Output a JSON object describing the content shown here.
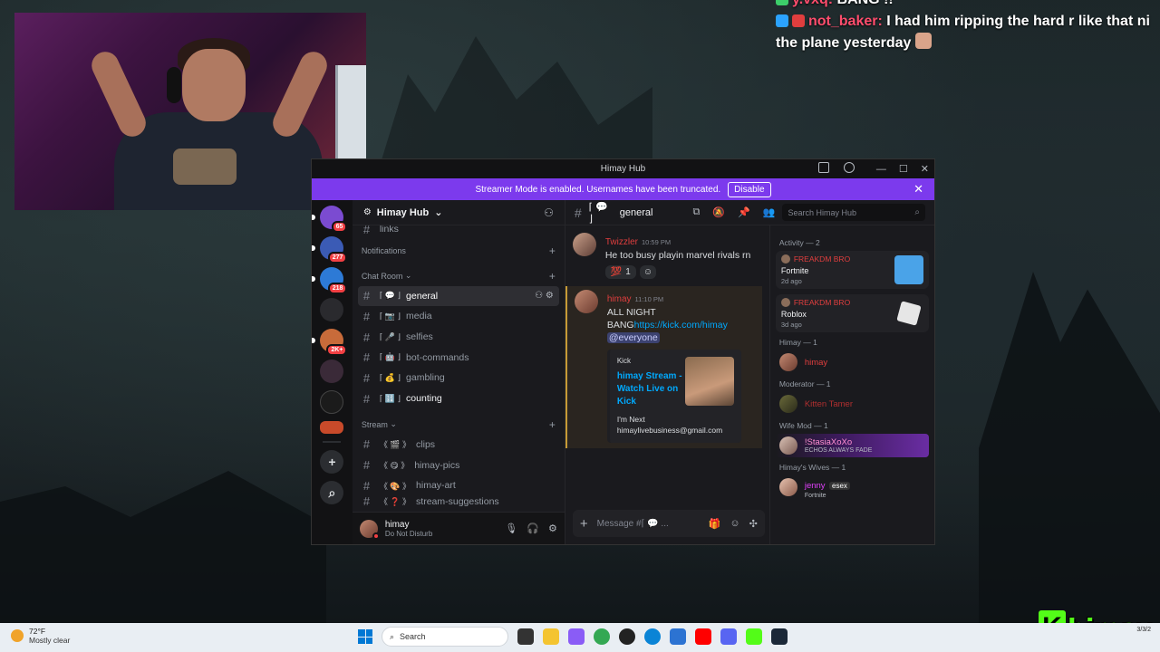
{
  "stream_chat": [
    {
      "user": "y.vxq:",
      "message": "BANG !!"
    },
    {
      "user": "not_baker:",
      "message": "I had him ripping the hard r like that ni",
      "message_line2": "the plane yesterday"
    }
  ],
  "window": {
    "title": "Himay Hub"
  },
  "banner": {
    "text": "Streamer Mode is enabled. Usernames have been truncated.",
    "button": "Disable",
    "close": "✕"
  },
  "rail": {
    "servers": [
      {
        "badge": "65",
        "color": "#7b4bd1"
      },
      {
        "badge": "277",
        "color": "#3b5bb5"
      },
      {
        "badge": "218",
        "color": "#2d7ad6"
      },
      {
        "badge": "",
        "color": "#2a2a2e"
      },
      {
        "badge": "2K+",
        "color": "#c86b3a"
      },
      {
        "badge": "",
        "color": "#3a2a38"
      },
      {
        "badge": "",
        "color": "#1b1b1b"
      },
      {
        "badge": "",
        "color": "#c84a2a"
      }
    ],
    "add_icon": "+",
    "explore_icon": "⌕"
  },
  "server": {
    "name": "Himay Hub",
    "chevron": "⌄"
  },
  "sidebar": {
    "top_partial": "links",
    "notifications_cat": "Notifications",
    "chatroom_cat": "Chat Room",
    "stream_cat": "Stream",
    "chatroom": [
      {
        "prefix": "⌈ 💬 ⌋",
        "name": "general",
        "active": true
      },
      {
        "prefix": "⌈ 📷 ⌋",
        "name": "media"
      },
      {
        "prefix": "⌈ 🎤 ⌋",
        "name": "selfies"
      },
      {
        "prefix": "⌈ 🤖 ⌋",
        "name": "bot-commands"
      },
      {
        "prefix": "⌈ 💰 ⌋",
        "name": "gambling"
      },
      {
        "prefix": "⌈ 🔢 ⌋",
        "name": "counting",
        "unread": true
      }
    ],
    "stream": [
      {
        "prefix": "《 🎬 》",
        "name": "clips"
      },
      {
        "prefix": "《 😋 》",
        "name": "himay-pics"
      },
      {
        "prefix": "《 🎨 》",
        "name": "himay-art"
      },
      {
        "prefix": "《 ❓ 》",
        "name": "stream-suggestions"
      }
    ]
  },
  "user_panel": {
    "name": "himay",
    "status": "Do Not Disturb"
  },
  "channel_header": {
    "prefix": "⌈ 💬 ⌋",
    "name": "general",
    "search_placeholder": "Search Himay Hub"
  },
  "messages": [
    {
      "author": "Twizzler",
      "time": "10:59 PM",
      "text": "He too busy playin marvel rivals rn",
      "reaction_emoji": "💯",
      "reaction_count": "1"
    },
    {
      "author": "himay",
      "time": "11:10 PM",
      "text_a": "ALL NIGHT",
      "text_b": "BANG",
      "link": "https://kick.com/himay",
      "mention": "@everyone",
      "embed": {
        "provider": "Kick",
        "title": "himay Stream - Watch Live on Kick",
        "description": "I'm Next himaylivebusiness@gmail.com"
      }
    }
  ],
  "composer": {
    "placeholder": "Message #⌈ 💬 ..."
  },
  "members": {
    "activity_cat": "Activity — 2",
    "activities": [
      {
        "user": "FREAKDM BRO",
        "game": "Fortnite",
        "time": "2d ago",
        "art_color": "#4aa3e8"
      },
      {
        "user": "FREAKDM BRO",
        "game": "Roblox",
        "time": "3d ago",
        "art_color": "#e6e6e6"
      }
    ],
    "groups": [
      {
        "title": "Himay — 1",
        "name": "himay",
        "color": "#e03e3e",
        "sub": ""
      },
      {
        "title": "Moderator — 1",
        "name": "Kitten Tamer",
        "color": "#b12f2f",
        "sub": ""
      },
      {
        "title": "Wife Mod — 1",
        "name": "!StasiaXoXo",
        "color": "#ff8fd1",
        "sub": "ECHOS ALWAYS FADE",
        "banner": true
      },
      {
        "title": "Himay's Wives — 1",
        "name": "jenny",
        "color": "#e040fb",
        "sub": "Fortnite",
        "tag": "esex"
      }
    ]
  },
  "taskbar": {
    "temp": "72°F",
    "weather": "Mostly clear",
    "search": "Search",
    "tray": "3/3/2"
  },
  "brand": {
    "letter": "K",
    "name": "himay"
  }
}
